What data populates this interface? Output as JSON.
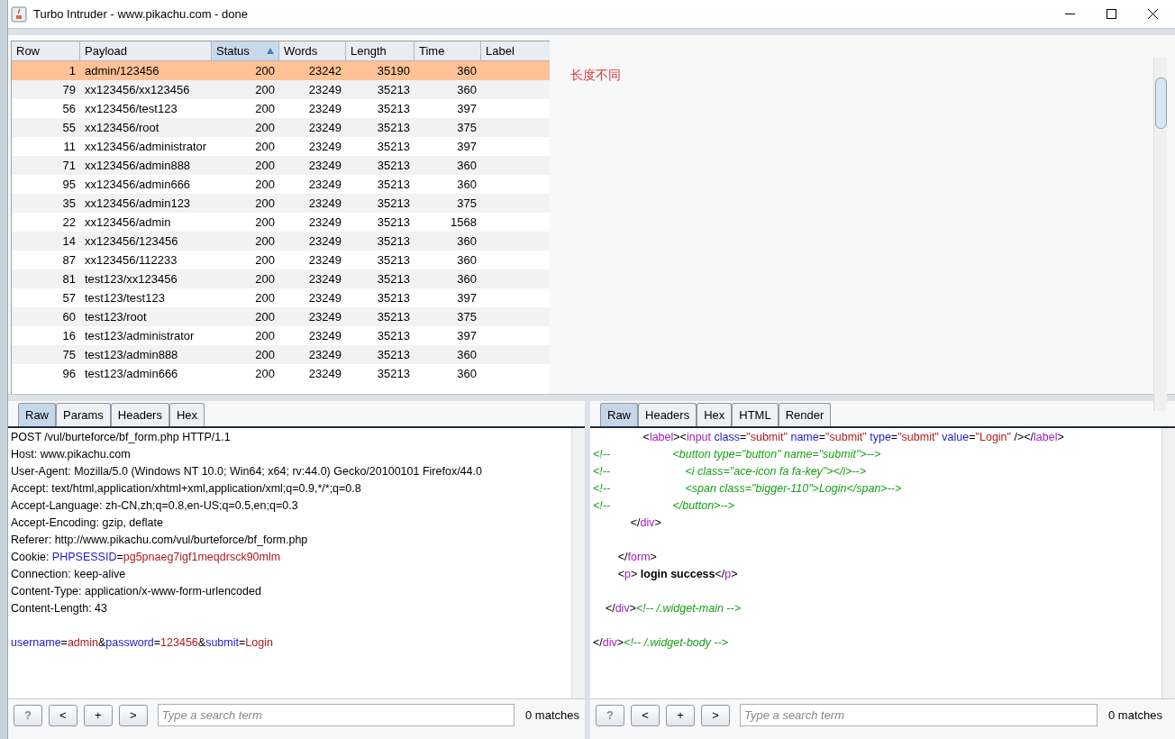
{
  "window": {
    "title": "Turbo Intruder - www.pikachu.com - done"
  },
  "table": {
    "columns": [
      {
        "label": "Row",
        "sorted": false,
        "kind": "number"
      },
      {
        "label": "Payload",
        "sorted": false,
        "kind": "text"
      },
      {
        "label": "Status",
        "sorted": true,
        "kind": "number"
      },
      {
        "label": "Words",
        "sorted": false,
        "kind": "number"
      },
      {
        "label": "Length",
        "sorted": false,
        "kind": "number"
      },
      {
        "label": "Time",
        "sorted": false,
        "kind": "number"
      },
      {
        "label": "Label",
        "sorted": false,
        "kind": "text"
      }
    ],
    "rows": [
      {
        "cells": [
          "1",
          "admin/123456",
          "200",
          "23242",
          "35190",
          "360"
        ],
        "selected": true
      },
      {
        "cells": [
          "79",
          "xx123456/xx123456",
          "200",
          "23249",
          "35213",
          "360"
        ],
        "selected": false
      },
      {
        "cells": [
          "56",
          "xx123456/test123",
          "200",
          "23249",
          "35213",
          "397"
        ],
        "selected": false
      },
      {
        "cells": [
          "55",
          "xx123456/root",
          "200",
          "23249",
          "35213",
          "375"
        ],
        "selected": false
      },
      {
        "cells": [
          "11",
          "xx123456/administrator",
          "200",
          "23249",
          "35213",
          "397"
        ],
        "selected": false
      },
      {
        "cells": [
          "71",
          "xx123456/admin888",
          "200",
          "23249",
          "35213",
          "360"
        ],
        "selected": false
      },
      {
        "cells": [
          "95",
          "xx123456/admin666",
          "200",
          "23249",
          "35213",
          "360"
        ],
        "selected": false
      },
      {
        "cells": [
          "35",
          "xx123456/admin123",
          "200",
          "23249",
          "35213",
          "375"
        ],
        "selected": false
      },
      {
        "cells": [
          "22",
          "xx123456/admin",
          "200",
          "23249",
          "35213",
          "1568"
        ],
        "selected": false
      },
      {
        "cells": [
          "14",
          "xx123456/123456",
          "200",
          "23249",
          "35213",
          "360"
        ],
        "selected": false
      },
      {
        "cells": [
          "87",
          "xx123456/112233",
          "200",
          "23249",
          "35213",
          "360"
        ],
        "selected": false
      },
      {
        "cells": [
          "81",
          "test123/xx123456",
          "200",
          "23249",
          "35213",
          "360"
        ],
        "selected": false
      },
      {
        "cells": [
          "57",
          "test123/test123",
          "200",
          "23249",
          "35213",
          "397"
        ],
        "selected": false
      },
      {
        "cells": [
          "60",
          "test123/root",
          "200",
          "23249",
          "35213",
          "375"
        ],
        "selected": false
      },
      {
        "cells": [
          "16",
          "test123/administrator",
          "200",
          "23249",
          "35213",
          "397"
        ],
        "selected": false
      },
      {
        "cells": [
          "75",
          "test123/admin888",
          "200",
          "23249",
          "35213",
          "360"
        ],
        "selected": false
      },
      {
        "cells": [
          "96",
          "test123/admin666",
          "200",
          "23249",
          "35213",
          "360"
        ],
        "selected": false
      }
    ]
  },
  "note": "长度不同",
  "request": {
    "tabs": [
      {
        "label": "Raw",
        "selected": true
      },
      {
        "label": "Params",
        "selected": false
      },
      {
        "label": "Headers",
        "selected": false
      },
      {
        "label": "Hex",
        "selected": false
      }
    ],
    "blocks": [
      [
        [
          {
            "kind": "plain",
            "text": "POST /vul/burteforce/bf_form.php HTTP/1.1"
          }
        ],
        [
          {
            "kind": "plain",
            "text": "Host: www.pikachu.com"
          }
        ],
        [
          {
            "kind": "plain",
            "text": "User-Agent: Mozilla/5.0 (Windows NT 10.0; Win64; x64; rv:44.0) Gecko/20100101 Firefox/44.0"
          }
        ],
        [
          {
            "kind": "plain",
            "text": "Accept: text/html,application/xhtml+xml,application/xml;q=0.9,*/*;q=0.8"
          }
        ],
        [
          {
            "kind": "plain",
            "text": "Accept-Language: zh-CN,zh;q=0.8,en-US;q=0.5,en;q=0.3"
          }
        ],
        [
          {
            "kind": "plain",
            "text": "Accept-Encoding: gzip, deflate"
          }
        ],
        [
          {
            "kind": "plain",
            "text": "Referer: http://www.pikachu.com/vul/burteforce/bf_form.php"
          }
        ],
        [
          {
            "kind": "plain",
            "text": "Cookie: "
          },
          {
            "kind": "key",
            "text": "PHPSESSID"
          },
          {
            "kind": "plain",
            "text": "="
          },
          {
            "kind": "value",
            "text": "pg5pnaeg7igf1meqdrsck90mlm"
          }
        ],
        [
          {
            "kind": "plain",
            "text": "Connection: keep-alive"
          }
        ],
        [
          {
            "kind": "plain",
            "text": "Content-Type: application/x-www-form-urlencoded"
          }
        ],
        [
          {
            "kind": "plain",
            "text": "Content-Length: 43"
          }
        ]
      ],
      [
        [
          {
            "kind": "key",
            "text": "username"
          },
          {
            "kind": "plain",
            "text": "="
          },
          {
            "kind": "value",
            "text": "admin"
          },
          {
            "kind": "plain",
            "text": "&"
          },
          {
            "kind": "key",
            "text": "password"
          },
          {
            "kind": "plain",
            "text": "="
          },
          {
            "kind": "value",
            "text": "123456"
          },
          {
            "kind": "plain",
            "text": "&"
          },
          {
            "kind": "key",
            "text": "submit"
          },
          {
            "kind": "plain",
            "text": "="
          },
          {
            "kind": "value",
            "text": "Login"
          }
        ]
      ]
    ],
    "search": {
      "buttons": [
        "?",
        "<",
        "+",
        ">"
      ],
      "placeholder": "Type a search term",
      "matches": "0 matches"
    }
  },
  "response": {
    "tabs": [
      {
        "label": "Raw",
        "selected": true
      },
      {
        "label": "Headers",
        "selected": false
      },
      {
        "label": "Hex",
        "selected": false
      },
      {
        "label": "HTML",
        "selected": false
      },
      {
        "label": "Render",
        "selected": false
      }
    ],
    "blocks": [
      [
        [
          {
            "kind": "plain",
            "text": "                <"
          },
          {
            "kind": "tag",
            "text": "label"
          },
          {
            "kind": "plain",
            "text": "><"
          },
          {
            "kind": "tag",
            "text": "input"
          },
          {
            "kind": "key",
            "text": " class"
          },
          {
            "kind": "plain",
            "text": "="
          },
          {
            "kind": "value",
            "text": "\"submit\""
          },
          {
            "kind": "key",
            "text": " name"
          },
          {
            "kind": "plain",
            "text": "="
          },
          {
            "kind": "value",
            "text": "\"submit\""
          },
          {
            "kind": "key",
            "text": " type"
          },
          {
            "kind": "plain",
            "text": "="
          },
          {
            "kind": "value",
            "text": "\"submit\""
          },
          {
            "kind": "key",
            "text": " value"
          },
          {
            "kind": "plain",
            "text": "="
          },
          {
            "kind": "value",
            "text": "\"Login\""
          },
          {
            "kind": "plain",
            "text": " /></"
          },
          {
            "kind": "tag",
            "text": "label"
          },
          {
            "kind": "plain",
            "text": ">"
          }
        ],
        [
          {
            "kind": "comment",
            "text": "<!--                    <button type=\"button\" name=\"submit\">-->"
          }
        ],
        [
          {
            "kind": "comment",
            "text": "<!--                        <i class=\"ace-icon fa fa-key\"></i>-->"
          }
        ],
        [
          {
            "kind": "comment",
            "text": "<!--                        <span class=\"bigger-110\">Login</span>-->"
          }
        ],
        [
          {
            "kind": "comment",
            "text": "<!--                    </button>-->"
          }
        ],
        [
          {
            "kind": "plain",
            "text": "            </"
          },
          {
            "kind": "tag",
            "text": "div"
          },
          {
            "kind": "plain",
            "text": ">"
          }
        ]
      ],
      [
        [
          {
            "kind": "plain",
            "text": "        </"
          },
          {
            "kind": "tag",
            "text": "form"
          },
          {
            "kind": "plain",
            "text": ">"
          }
        ],
        [
          {
            "kind": "plain",
            "text": "        <"
          },
          {
            "kind": "tag",
            "text": "p"
          },
          {
            "kind": "plain",
            "text": "> "
          },
          {
            "kind": "bold",
            "text": "login success"
          },
          {
            "kind": "plain",
            "text": "</"
          },
          {
            "kind": "tag",
            "text": "p"
          },
          {
            "kind": "plain",
            "text": ">"
          }
        ]
      ],
      [
        [
          {
            "kind": "plain",
            "text": "    </"
          },
          {
            "kind": "tag",
            "text": "div"
          },
          {
            "kind": "plain",
            "text": ">"
          },
          {
            "kind": "comment",
            "text": "<!-- /.widget-main -->"
          }
        ]
      ],
      [
        [
          {
            "kind": "plain",
            "text": "</"
          },
          {
            "kind": "tag",
            "text": "div"
          },
          {
            "kind": "plain",
            "text": ">"
          },
          {
            "kind": "comment",
            "text": "<!-- /.widget-body -->"
          }
        ]
      ]
    ],
    "search": {
      "buttons": [
        "?",
        "<",
        "+",
        ">"
      ],
      "placeholder": "Type a search term",
      "matches": "0 matches"
    }
  }
}
